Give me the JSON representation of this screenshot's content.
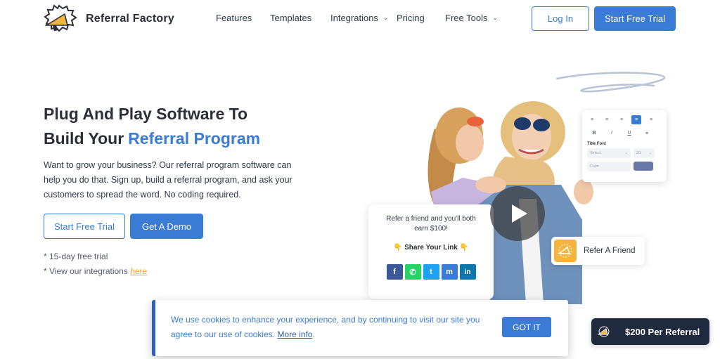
{
  "header": {
    "brand": "Referral Factory",
    "nav": [
      {
        "label": "Features",
        "dropdown": false
      },
      {
        "label": "Templates",
        "dropdown": false
      },
      {
        "label": "Integrations",
        "dropdown": true
      },
      {
        "label": "Pricing",
        "dropdown": false
      },
      {
        "label": "Free Tools",
        "dropdown": true
      }
    ],
    "login_label": "Log In",
    "trial_label": "Start Free Trial"
  },
  "hero": {
    "title_line1": "Plug And Play Software To",
    "title_line2": "Build Your",
    "title_accent": "Referral Program",
    "description": "Want to grow your business? Our referral program software can help you do that. Sign up, build a referral program, and ask your customers to spread the word. No coding required.",
    "trial_label": "Start Free Trial",
    "demo_label": "Get A Demo",
    "note_trial": "* 15-day free trial",
    "note_integrations": "* View our integrations",
    "note_link": "here"
  },
  "editor": {
    "title_font_label": "Title Font",
    "select_placeholder": "Select",
    "size_value": "20",
    "color_label": "Color",
    "toolbar_row1": [
      "align-left-icon",
      "align-justify-icon",
      "align-left-alt-icon",
      "align-center-icon",
      "align-right-icon"
    ],
    "toolbar_row2": [
      "B",
      "I",
      "U",
      "link-icon"
    ]
  },
  "share_card": {
    "text": "Refer a friend and you'll both earn $100!",
    "link_label": "👇 Share Your Link 👇",
    "socials": [
      {
        "icon": "facebook-icon",
        "glyph": "f",
        "color": "#3b5998"
      },
      {
        "icon": "whatsapp-icon",
        "glyph": "✆",
        "color": "#25d366"
      },
      {
        "icon": "twitter-icon",
        "glyph": "t",
        "color": "#1da1f2"
      },
      {
        "icon": "messenger-icon",
        "glyph": "m",
        "color": "#3a7bd5"
      },
      {
        "icon": "linkedin-icon",
        "glyph": "in",
        "color": "#0e76a8"
      }
    ]
  },
  "refer_card": {
    "label": "Refer A Friend"
  },
  "cookie": {
    "text": "We use cookies to enhance your experience, and by continuing to visit our site you agree to our use of cookies.",
    "link": "More info",
    "button": "GOT IT"
  },
  "badge": {
    "label": "$200 Per Referral"
  },
  "colors": {
    "primary": "#3a7bd5",
    "accent": "#f3b53f",
    "dark": "#1f2a3e"
  }
}
